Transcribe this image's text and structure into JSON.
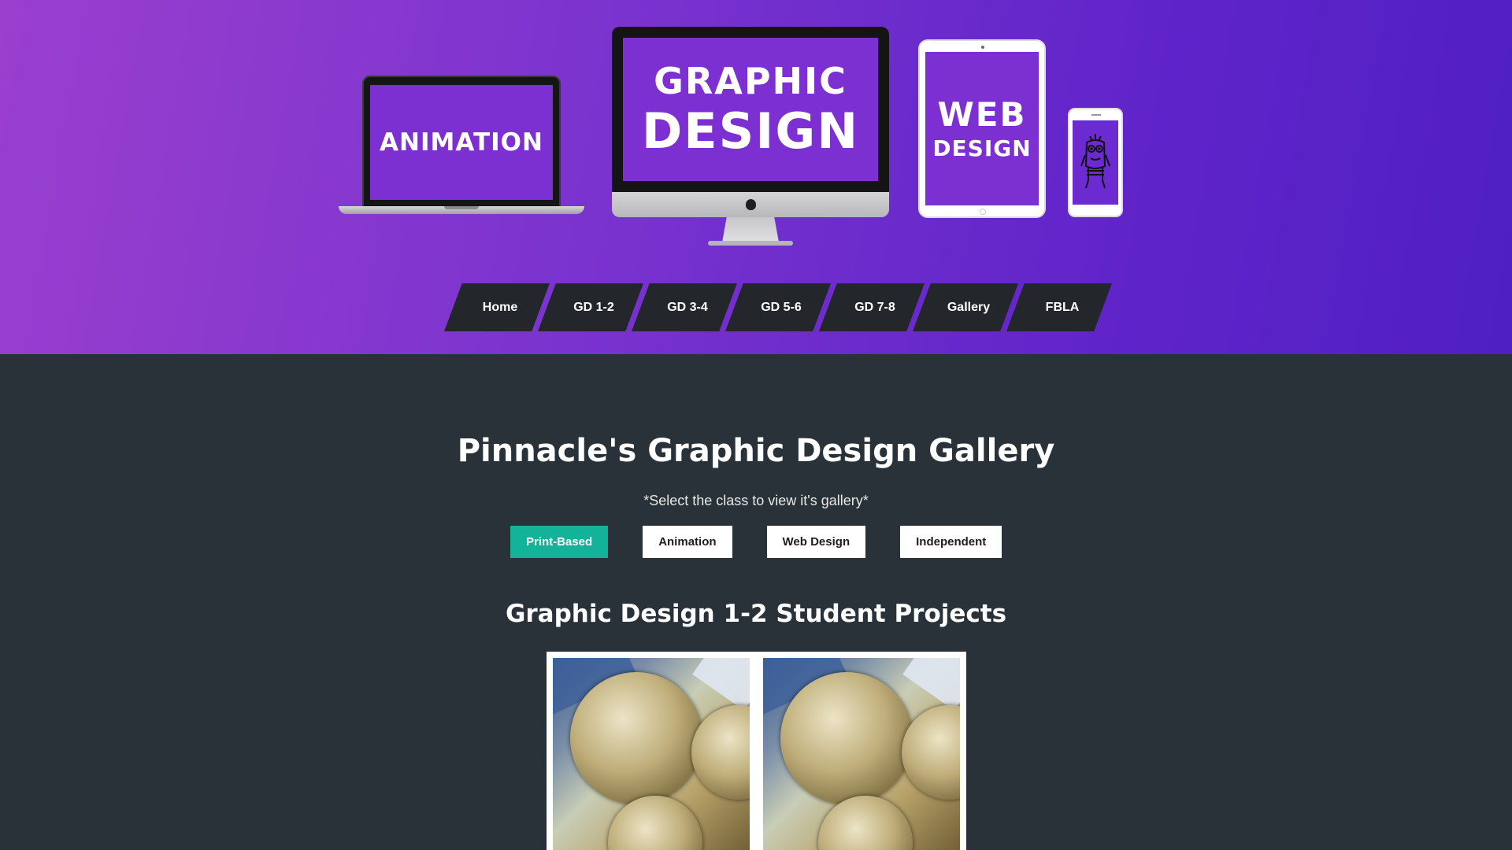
{
  "hero": {
    "laptop_screen": "ANIMATION",
    "imac_screen_line1": "GRAPHIC",
    "imac_screen_line2": "DESIGN",
    "tablet_screen_line1": "WEB",
    "tablet_screen_line2": "DESIGN",
    "colors": {
      "gradient_start": "#9a3fce",
      "gradient_end": "#4f1fc4",
      "screen": "#7c30d2"
    }
  },
  "nav": {
    "items": [
      {
        "label": "Home"
      },
      {
        "label": "GD 1-2"
      },
      {
        "label": "GD 3-4"
      },
      {
        "label": "GD 5-6"
      },
      {
        "label": "GD 7-8"
      },
      {
        "label": "Gallery"
      },
      {
        "label": "FBLA"
      }
    ]
  },
  "main": {
    "title": "Pinnacle's Graphic Design Gallery",
    "subtitle": "*Select the class to view it's gallery*",
    "filters": [
      {
        "label": "Print-Based",
        "active": true
      },
      {
        "label": "Animation",
        "active": false
      },
      {
        "label": "Web Design",
        "active": false
      },
      {
        "label": "Independent",
        "active": false
      }
    ],
    "section_title": "Graphic Design 1-2 Student Projects",
    "colors": {
      "background": "#283238",
      "active_filter": "#13b39a"
    }
  }
}
